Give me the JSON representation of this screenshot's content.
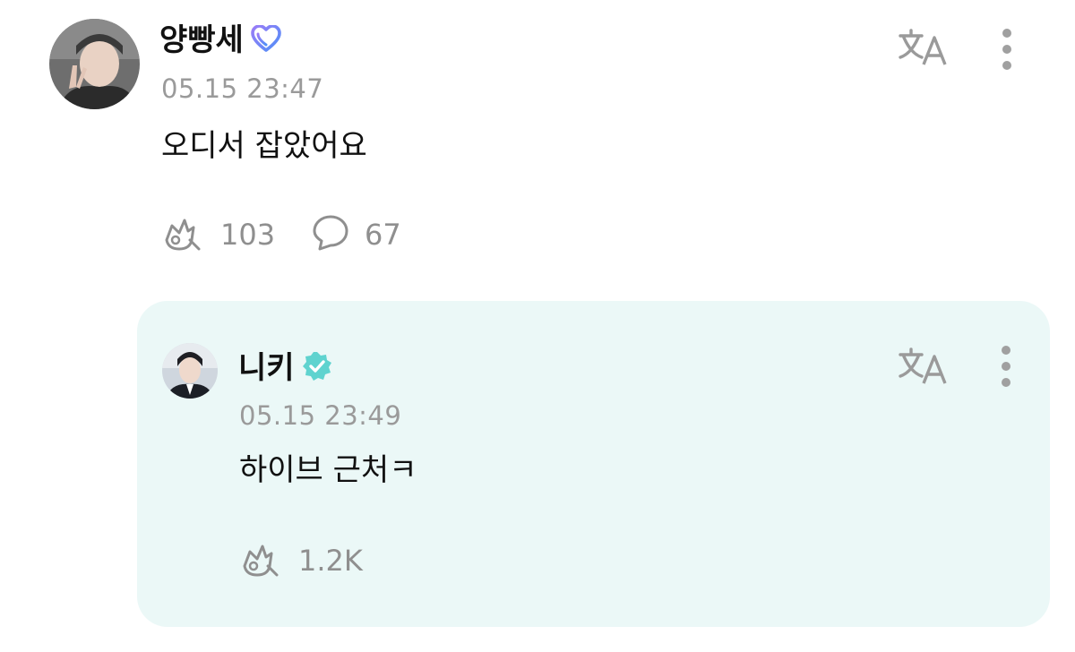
{
  "post": {
    "author": "양빵세",
    "timestamp": "05.15 23:47",
    "text": "오디서 잡았어요",
    "likes": "103",
    "comments": "67",
    "badge_color": "#8b7cf6"
  },
  "reply": {
    "author": "니키",
    "timestamp": "05.15 23:49",
    "text": "하이브 근처ㅋ",
    "likes": "1.2K",
    "badge_color": "#5fd3cf",
    "card_color": "#ebf8f7"
  },
  "icons": {
    "translate": "translate-icon",
    "more": "more-vertical-icon",
    "like": "like-icon",
    "comment": "comment-icon"
  }
}
